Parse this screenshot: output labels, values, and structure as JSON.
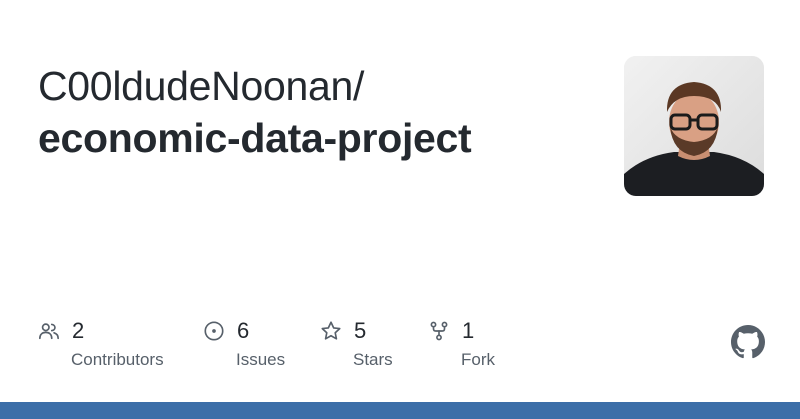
{
  "repo": {
    "owner_with_slash": "C00ldudeNoonan/",
    "name": "economic-data-project"
  },
  "stats": [
    {
      "icon": "people-icon",
      "value": "2",
      "label": "Contributors"
    },
    {
      "icon": "issue-opened-icon",
      "value": "6",
      "label": "Issues"
    },
    {
      "icon": "star-icon",
      "value": "5",
      "label": "Stars"
    },
    {
      "icon": "repo-forked-icon",
      "value": "1",
      "label": "Fork"
    }
  ],
  "colors": {
    "text_primary": "#24292f",
    "text_secondary": "#57606a",
    "icon": "#57606a",
    "bottom_bar": "#3c6ea8"
  }
}
